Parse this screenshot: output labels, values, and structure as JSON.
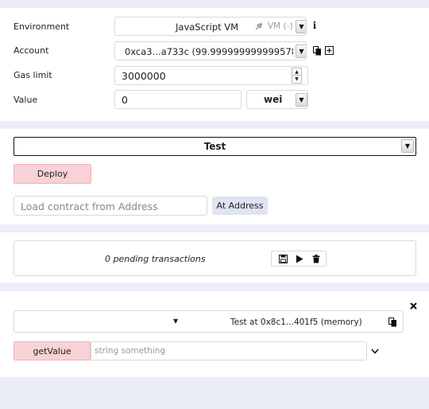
{
  "settings": {
    "environment_label": "Environment",
    "environment_value": "JavaScript VM",
    "vm_badge": "VM (-)",
    "account_label": "Account",
    "account_value": "0xca3...a733c (99.999999999999578",
    "gas_limit_label": "Gas limit",
    "gas_limit_value": "3000000",
    "value_label": "Value",
    "value_amount": "0",
    "value_unit": "wei"
  },
  "deploy": {
    "contract_selected": "Test",
    "deploy_label": "Deploy",
    "address_placeholder": "Load contract from Address",
    "at_address_label": "At Address"
  },
  "pending": {
    "text": "0 pending transactions"
  },
  "instance": {
    "title": "Test at 0x8c1...401f5 (memory)",
    "function_label": "getValue",
    "function_input_placeholder": "string something"
  },
  "colors": {
    "page_bg": "#eceef7",
    "deploy_bg": "#f7d2d6",
    "at_address_bg": "#dfe3f2"
  },
  "icons": {
    "info": "info-icon",
    "copy": "copy-icon",
    "add": "plus-square-icon",
    "save": "save-icon",
    "play": "play-icon",
    "trash": "trash-icon",
    "close": "close-icon",
    "chevron": "chevron-down-icon",
    "plug": "plug-icon"
  }
}
